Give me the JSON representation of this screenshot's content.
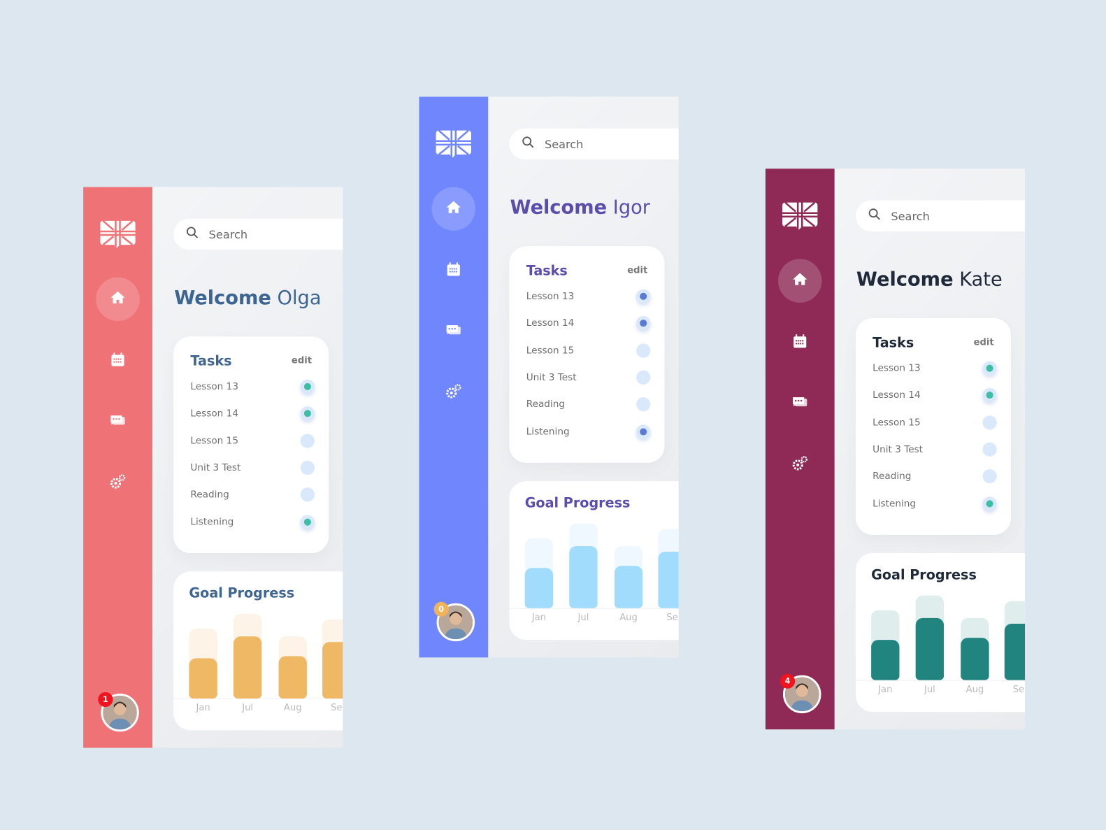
{
  "search_placeholder": "Search",
  "welcome_word": "Welcome",
  "tasks_title": "Tasks",
  "edit_label": "edit",
  "goal_title": "Goal Progress",
  "months": [
    "Jan",
    "Jul",
    "Aug",
    "Se"
  ],
  "goal_values": {
    "target": [
      95,
      115,
      85,
      108
    ],
    "achieved": [
      55,
      85,
      58,
      77
    ]
  },
  "task_labels": [
    "Lesson 13",
    "Lesson 14",
    "Lesson 15",
    "Unit 3 Test",
    "Reading",
    "Listening"
  ],
  "panels": [
    {
      "user": "Olga",
      "notifications": "1",
      "tasks_done": [
        true,
        true,
        false,
        false,
        false,
        true
      ],
      "colors": {
        "sidebar": "#ef7277",
        "title": "#3d6591",
        "bar": "#efb865",
        "bar_bg": "#fdf3e6",
        "dot": "#3dbfa5",
        "badge": "#f0141e"
      }
    },
    {
      "user": "Igor",
      "notifications": "0",
      "tasks_done": [
        true,
        true,
        false,
        false,
        false,
        true
      ],
      "colors": {
        "sidebar": "#6f86fc",
        "title": "#5b4cae",
        "bar": "#a2dcfc",
        "bar_bg": "#eef8fe",
        "dot": "#5a7ad6",
        "badge": "#f0b25a"
      }
    },
    {
      "user": "Kate",
      "notifications": "4",
      "tasks_done": [
        true,
        true,
        false,
        false,
        false,
        true
      ],
      "colors": {
        "sidebar": "#8e2a55",
        "title": "#1e2a3a",
        "bar": "#21847f",
        "bar_bg": "#dfeeed",
        "dot": "#3dbfa5",
        "badge": "#f0141e"
      }
    }
  ]
}
